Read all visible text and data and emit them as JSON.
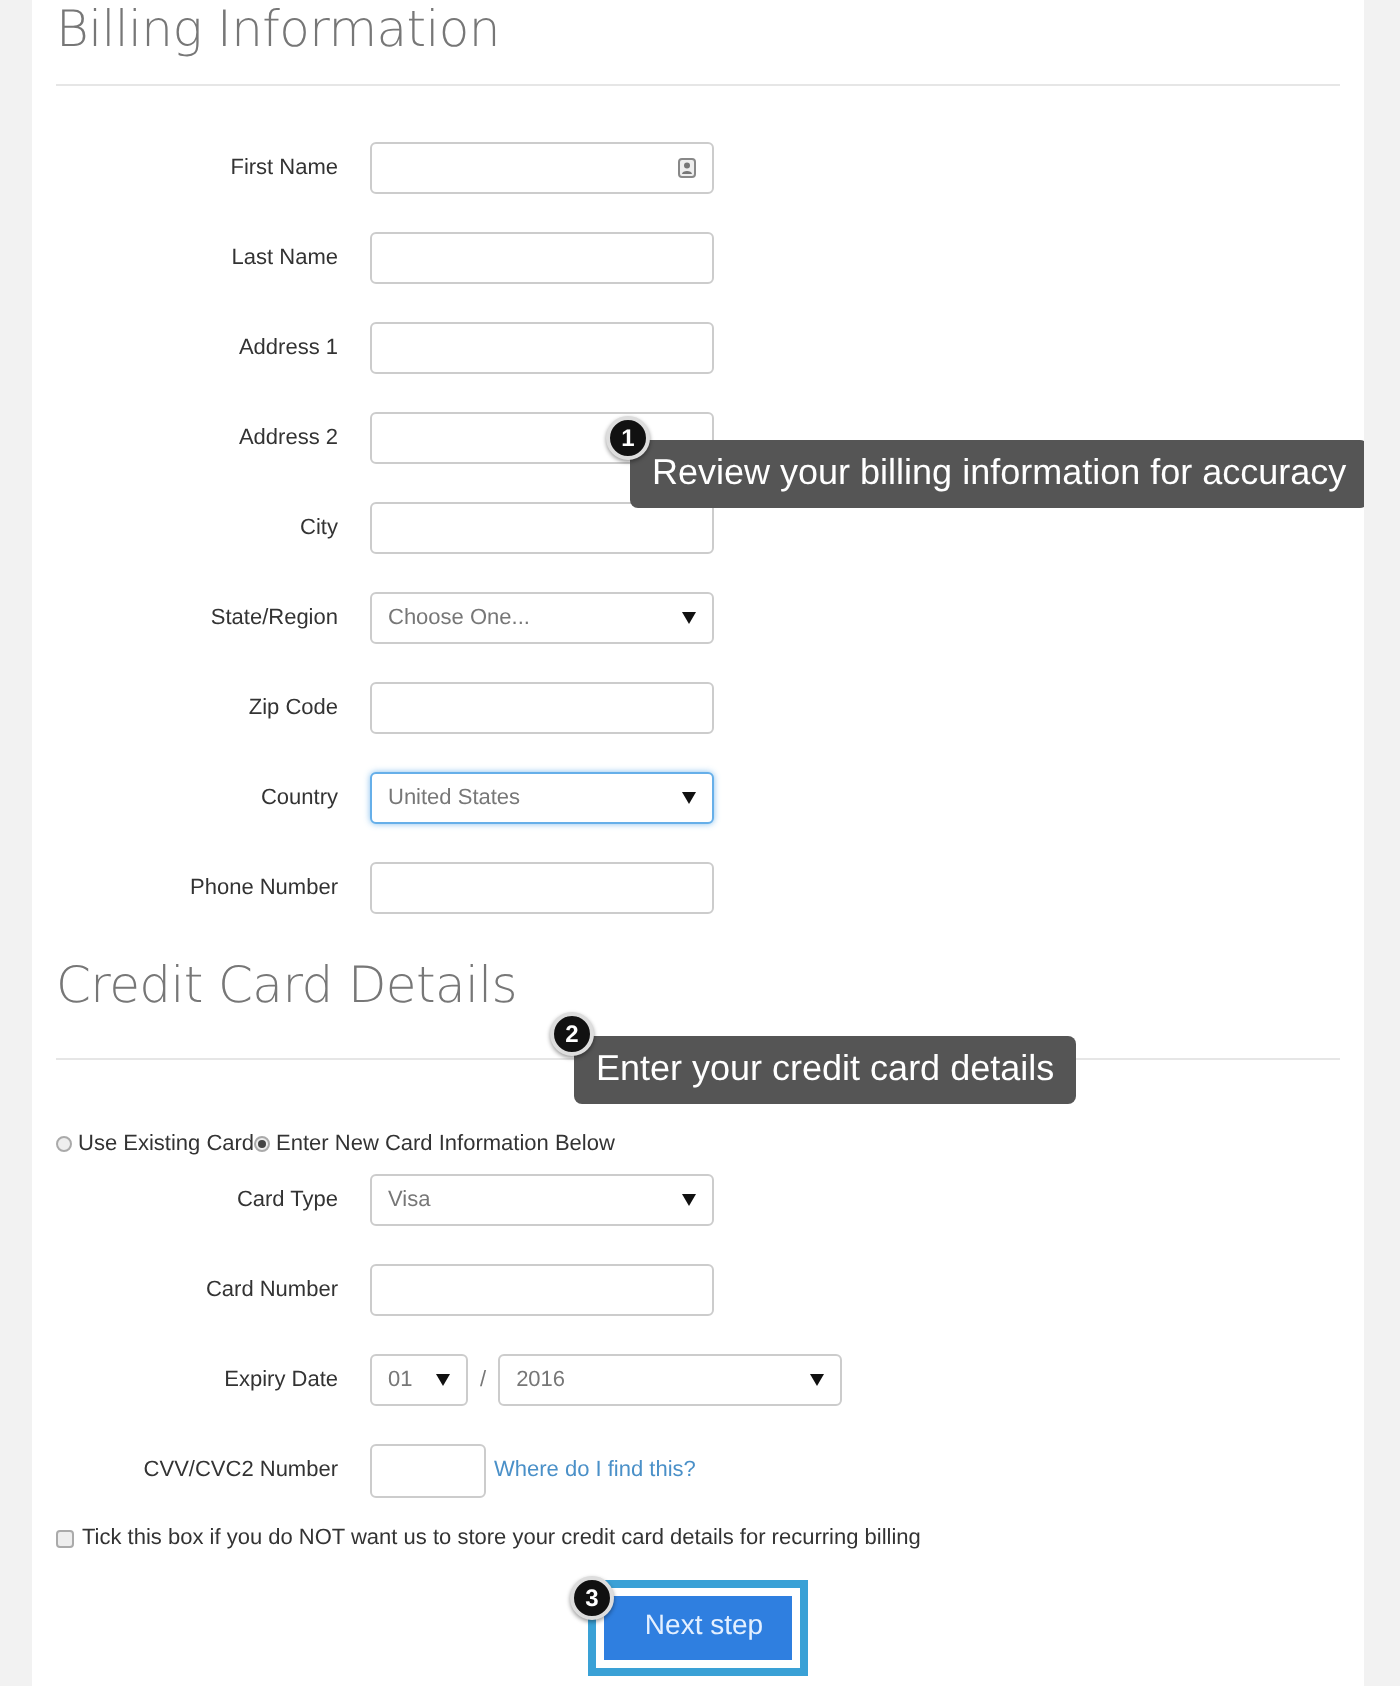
{
  "billing": {
    "heading": "Billing Information",
    "fields": [
      {
        "label": "First Name",
        "kind": "text",
        "focused": false,
        "autofill_icon": true
      },
      {
        "label": "Last Name",
        "kind": "text",
        "focused": false,
        "autofill_icon": false
      },
      {
        "label": "Address 1",
        "kind": "text",
        "focused": false,
        "autofill_icon": false
      },
      {
        "label": "Address 2",
        "kind": "text",
        "focused": false,
        "autofill_icon": false
      },
      {
        "label": "City",
        "kind": "text",
        "focused": false,
        "autofill_icon": false
      },
      {
        "label": "State/Region",
        "kind": "select",
        "value": "Choose One...",
        "focused": false,
        "autofill_icon": false
      },
      {
        "label": "Zip Code",
        "kind": "text",
        "focused": false,
        "autofill_icon": false
      },
      {
        "label": "Country",
        "kind": "select",
        "value": "United States",
        "focused": true,
        "autofill_icon": false
      },
      {
        "label": "Phone Number",
        "kind": "text",
        "focused": false,
        "autofill_icon": false
      }
    ]
  },
  "credit_card": {
    "heading": "Credit Card Details",
    "card_options": [
      {
        "label": "Use Existing Card",
        "selected": false
      },
      {
        "label": "Enter New Card Information Below",
        "selected": true
      }
    ],
    "fields": [
      {
        "label": "Card Type",
        "kind": "select",
        "value": "Visa"
      },
      {
        "label": "Card Number",
        "kind": "text"
      },
      {
        "label": "Expiry Date",
        "kind": "expiry",
        "month": "01",
        "separator": "/",
        "year": "2016"
      },
      {
        "label": "CVV/CVC2 Number",
        "kind": "cvv",
        "help_link": "Where do I find this?"
      }
    ],
    "no_store_checkbox": {
      "label": "Tick this box if you do NOT want us to store your credit card details for recurring billing",
      "checked": false
    },
    "next_button": {
      "label": "Next step",
      "highlighted": true
    }
  },
  "annotations": [
    {
      "number": "1",
      "text": "Review your billing information for accuracy"
    },
    {
      "number": "2",
      "text": "Enter your credit card details"
    },
    {
      "number": "3"
    }
  ]
}
